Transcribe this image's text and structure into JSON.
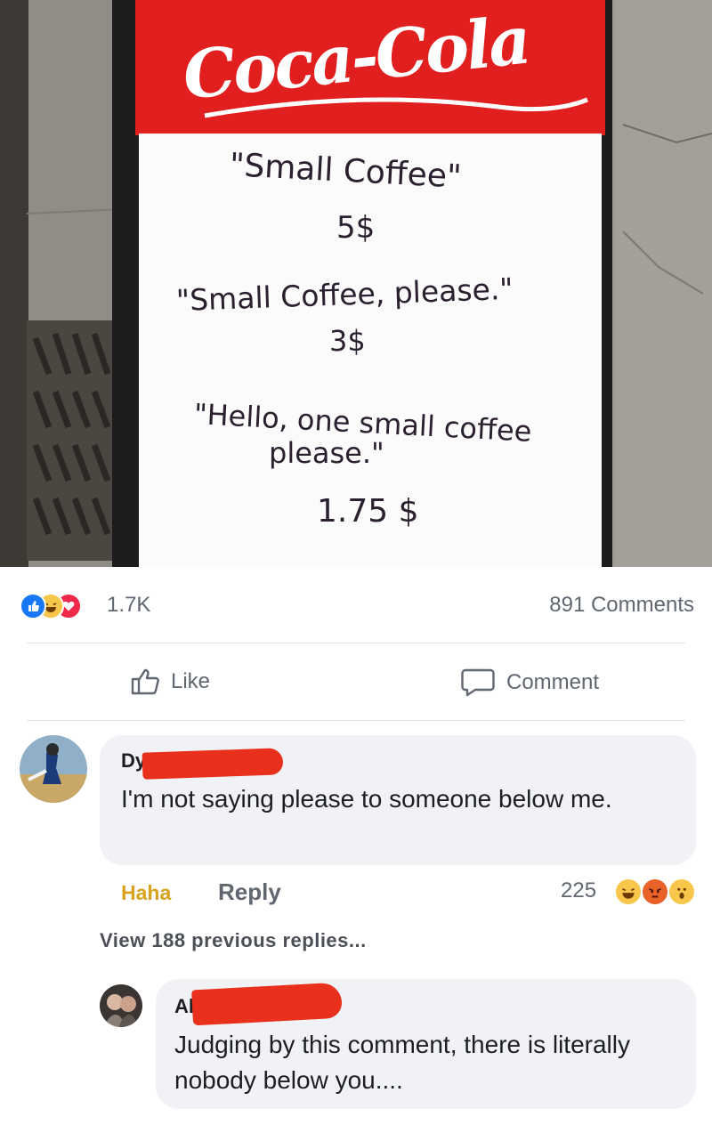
{
  "photo": {
    "logo_text": "Coca-Cola",
    "sign_lines": [
      "\"Small Coffee\"",
      "5$",
      "\"Small Coffee, please.\"",
      "3$",
      "\"Hello, one small coffee",
      "please.\"",
      "1.75 $"
    ]
  },
  "stats": {
    "reaction_icons": [
      "like-icon",
      "haha-icon",
      "love-icon"
    ],
    "reaction_count": "1.7K",
    "comments_count": "891 Comments"
  },
  "actions": {
    "like_label": "Like",
    "comment_label": "Comment"
  },
  "comments": [
    {
      "author_visible": "Dy.",
      "text": "I'm not saying please to someone below me.",
      "haha_label": "Haha",
      "reply_label": "Reply",
      "reaction_count": "225",
      "reaction_icons": [
        "haha-icon",
        "angry-icon",
        "wow-icon"
      ]
    }
  ],
  "view_replies": "View 188 previous replies...",
  "reply": {
    "author_visible": "Ale.",
    "text": "Judging by this comment, there is literally nobody below you...."
  },
  "colors": {
    "facebook_blue": "#1877f2",
    "haha_yellow": "#f7c64a",
    "love_red": "#f0284a",
    "coke_red": "#e21f1f",
    "redaction_red": "#e8301c"
  }
}
